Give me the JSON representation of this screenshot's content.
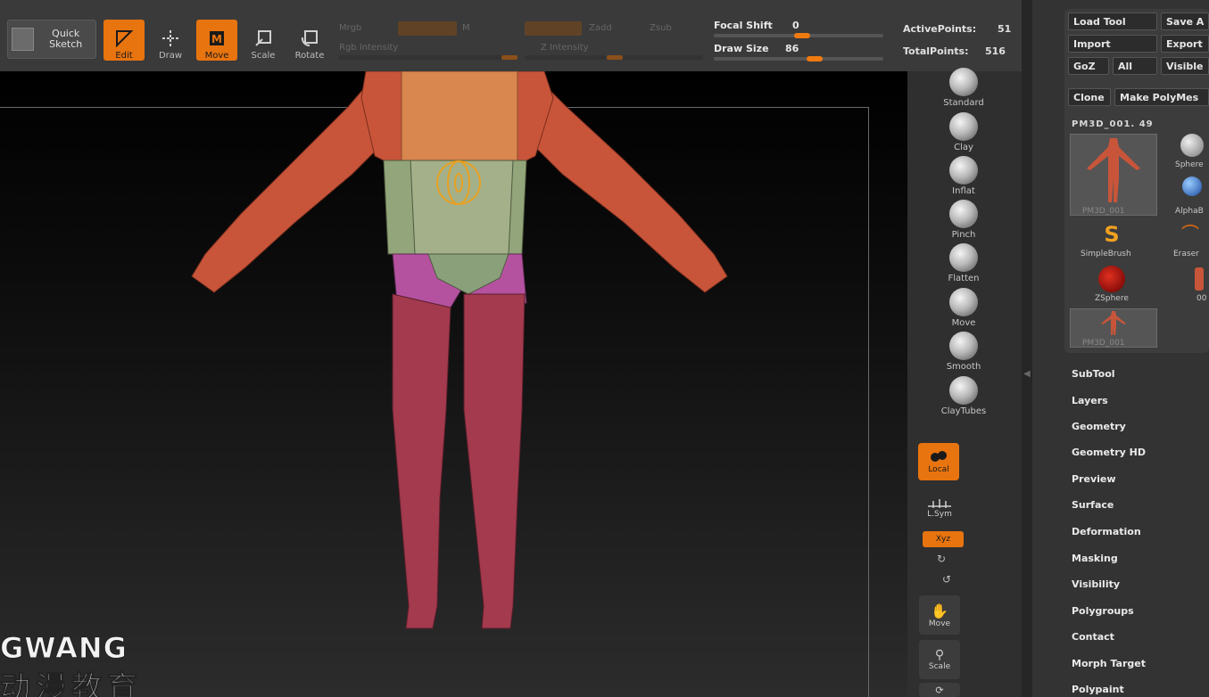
{
  "toolbar": {
    "quick_sketch": "Quick\nSketch",
    "tools": [
      {
        "label": "Edit",
        "active": true
      },
      {
        "label": "Draw",
        "active": false
      },
      {
        "label": "Move",
        "active": true
      },
      {
        "label": "Scale",
        "active": false
      },
      {
        "label": "Rotate",
        "active": false
      }
    ],
    "mrgb": "Mrgb",
    "m": "M",
    "rgb_intensity": "Rgb Intensity",
    "zadd": "Zadd",
    "zsub": "Zsub",
    "z_intensity": "Z Intensity",
    "focal_shift_label": "Focal Shift",
    "focal_shift_value": "0",
    "draw_size_label": "Draw Size",
    "draw_size_value": "86",
    "active_points_label": "ActivePoints:",
    "active_points_value": "51",
    "total_points_label": "TotalPoints:",
    "total_points_value": "516"
  },
  "shelf": {
    "brushes": [
      "Standard",
      "Clay",
      "Inflat",
      "Pinch",
      "Flatten",
      "Move",
      "Smooth",
      "ClayTubes"
    ],
    "local": "Local",
    "lsym": "L.Sym",
    "xyz": "Xyz",
    "move": "Move",
    "scale": "Scale"
  },
  "tool_panel": {
    "buttons": [
      "Load Tool",
      "Save A",
      "Import",
      "Export",
      "GoZ",
      "All",
      "Visible",
      "Clone",
      "Make PolyMes"
    ],
    "tool_name": "PM3D_001. 49",
    "thumbs": [
      {
        "label": "PM3D_001",
        "dim": true
      },
      {
        "label": "Sphere",
        "dim": false
      },
      {
        "label": "AlphaB",
        "dim": false
      },
      {
        "label": "SimpleBrush",
        "dim": false
      },
      {
        "label": "Eraser",
        "dim": false
      },
      {
        "label": "ZSphere",
        "dim": false
      },
      {
        "label": "00",
        "dim": false
      },
      {
        "label": "PM3D_001",
        "dim": true
      }
    ]
  },
  "menu": [
    "SubTool",
    "Layers",
    "Geometry",
    "Geometry HD",
    "Preview",
    "Surface",
    "Deformation",
    "Masking",
    "Visibility",
    "Polygroups",
    "Contact",
    "Morph Target",
    "Polypaint"
  ],
  "watermark": {
    "en": "GWANG",
    "cn": "动漫教育"
  },
  "colors": {
    "accent": "#e8740f",
    "skin": "#c8553a",
    "torso": "#d9864f",
    "waist": "#93a57a",
    "legs": "#a33a4e",
    "hips": "#b552a0"
  }
}
